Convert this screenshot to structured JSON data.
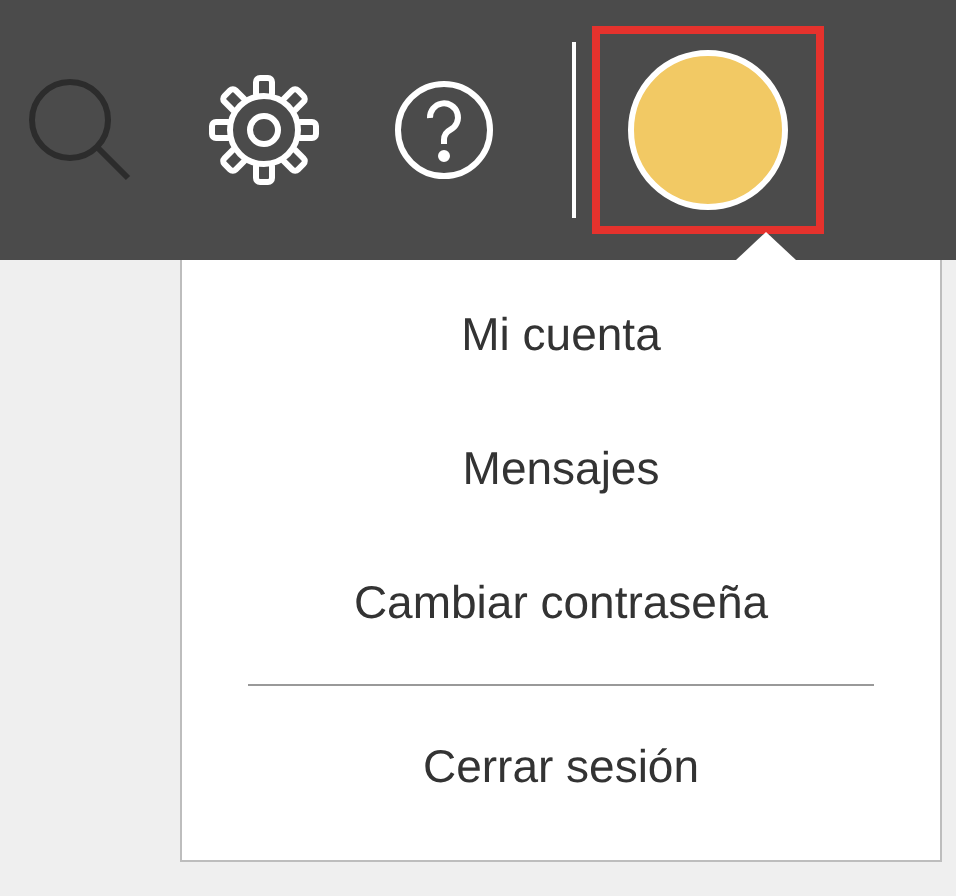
{
  "toolbar": {
    "icons": [
      {
        "kind": "search",
        "disabled": true
      },
      {
        "kind": "settings",
        "disabled": false
      },
      {
        "kind": "help",
        "disabled": false
      }
    ],
    "avatar": {
      "color": "#f2c964",
      "highlighted": true,
      "expanded": true
    }
  },
  "menu": {
    "items": [
      {
        "kind": "link",
        "label": "Mi cuenta"
      },
      {
        "kind": "link",
        "label": "Mensajes"
      },
      {
        "kind": "link",
        "label": "Cambiar contraseña"
      },
      {
        "kind": "separator"
      },
      {
        "kind": "link",
        "label": "Cerrar sesión"
      }
    ]
  }
}
